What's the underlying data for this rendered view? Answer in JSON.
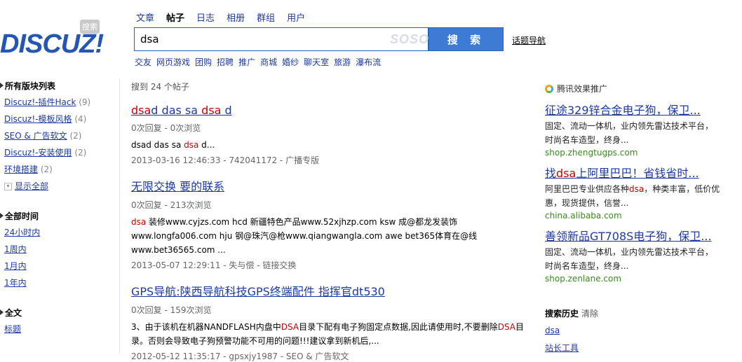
{
  "logo": {
    "text": "DISCUZ!",
    "badge": "搜索"
  },
  "tabs": [
    {
      "label": "文章",
      "active": false
    },
    {
      "label": "帖子",
      "active": true
    },
    {
      "label": "日志",
      "active": false
    },
    {
      "label": "相册",
      "active": false
    },
    {
      "label": "群组",
      "active": false
    },
    {
      "label": "用户",
      "active": false
    }
  ],
  "search": {
    "value": "dsa",
    "watermark": "SOSO",
    "button": "搜 索",
    "topic_nav": "话题导航"
  },
  "hot_links": [
    "交友",
    "网页游戏",
    "团购",
    "招聘",
    "推广",
    "商城",
    "婚纱",
    "聊天室",
    "旅游",
    "瀑布流"
  ],
  "sidebar": {
    "forums_head": "所有版块列表",
    "forums": [
      {
        "label": "Discuz!-插件Hack",
        "count": "(9)"
      },
      {
        "label": "Discuz!-模板风格",
        "count": "(4)"
      },
      {
        "label": "SEO & 广告软文",
        "count": "(2)"
      },
      {
        "label": "Discuz!-安装使用",
        "count": "(2)"
      },
      {
        "label": "环境搭建",
        "count": "(2)"
      }
    ],
    "show_all": "显示全部",
    "time_head": "全部时间",
    "times": [
      "24小时内",
      "1周内",
      "1月内",
      "1年内"
    ],
    "scope_head": "全文",
    "scopes": [
      "标题"
    ]
  },
  "results": {
    "count_text": "搜到 24 个帖子",
    "items": [
      {
        "title": [
          {
            "hl": true,
            "t": "dsa"
          },
          {
            "hl": false,
            "t": "d das sa "
          },
          {
            "hl": true,
            "t": "dsa"
          },
          {
            "hl": false,
            "t": " d"
          }
        ],
        "meta": "0次回复 - 0次浏览",
        "snippet": [
          {
            "hl": false,
            "t": "dsad das sa "
          },
          {
            "hl": true,
            "t": "dsa"
          },
          {
            "hl": false,
            "t": " d..."
          }
        ],
        "footer": "2013-03-16 12:46:33 - 742041172 - 广播专版"
      },
      {
        "title": [
          {
            "hl": false,
            "t": "无限交换 要的联系"
          }
        ],
        "meta": "0次回复 - 213次浏览",
        "snippet": [
          {
            "hl": true,
            "t": "dsa"
          },
          {
            "hl": false,
            "t": " 装修www.cyjzs.com hcd 新疆特色产品www.52xjhzp.com ksw 成@都龙发装饰www.longfa006.com hju 钢@珠汽@枪www.qiangwangla.com awe bet365体育在@线www.bet36565.com ..."
          }
        ],
        "footer": "2013-05-07 12:29:11 - 失与偿 - 链接交换"
      },
      {
        "title": [
          {
            "hl": false,
            "t": "GPS导航:陕西导航科技GPS终端配件 指挥官dt530"
          }
        ],
        "meta": "0次回复 - 159次浏览",
        "snippet": [
          {
            "hl": false,
            "t": "3、由于该机在机器NANDFLASH内盘中"
          },
          {
            "hl": true,
            "t": "DSA"
          },
          {
            "hl": false,
            "t": "目录下配有电子狗固定点数据,因此请使用时,不要删除"
          },
          {
            "hl": true,
            "t": "DSA"
          },
          {
            "hl": false,
            "t": "目录。否则会导致电子狗预警功能不可用的问题!!!建议拿到新机后,..."
          }
        ],
        "footer": "2012-05-12 11:35:17 - gpsxjy1987 - SEO & 广告软文"
      }
    ]
  },
  "ads": {
    "head": "腾讯效果推广",
    "items": [
      {
        "title": [
          {
            "hl": false,
            "t": "征途329锌合金电子狗，保卫..."
          }
        ],
        "desc": [
          {
            "hl": false,
            "t": "固定、流动一体机，业内领先雷达技术平台，时尚名车造型，终身..."
          }
        ],
        "url": "shop.zhengtugps.com"
      },
      {
        "title": [
          {
            "hl": false,
            "t": "找"
          },
          {
            "hl": true,
            "t": "dsa"
          },
          {
            "hl": false,
            "t": "上阿里巴巴！省钱省时..."
          }
        ],
        "desc": [
          {
            "hl": false,
            "t": "阿里巴巴专业供应各种"
          },
          {
            "hl": true,
            "t": "dsa"
          },
          {
            "hl": false,
            "t": "，种类丰富，低价优惠，现货提供，信誉..."
          }
        ],
        "url": "china.alibaba.com"
      },
      {
        "title": [
          {
            "hl": false,
            "t": "善领新品GT708S电子狗，保卫..."
          }
        ],
        "desc": [
          {
            "hl": false,
            "t": "固定、流动一体机，业内领先雷达技术平台，时尚名车造型，终身..."
          }
        ],
        "url": "shop.zenlane.com"
      }
    ]
  },
  "history": {
    "head": "搜索历史",
    "clear": "清除",
    "items": [
      "dsa",
      "站长工具"
    ]
  }
}
